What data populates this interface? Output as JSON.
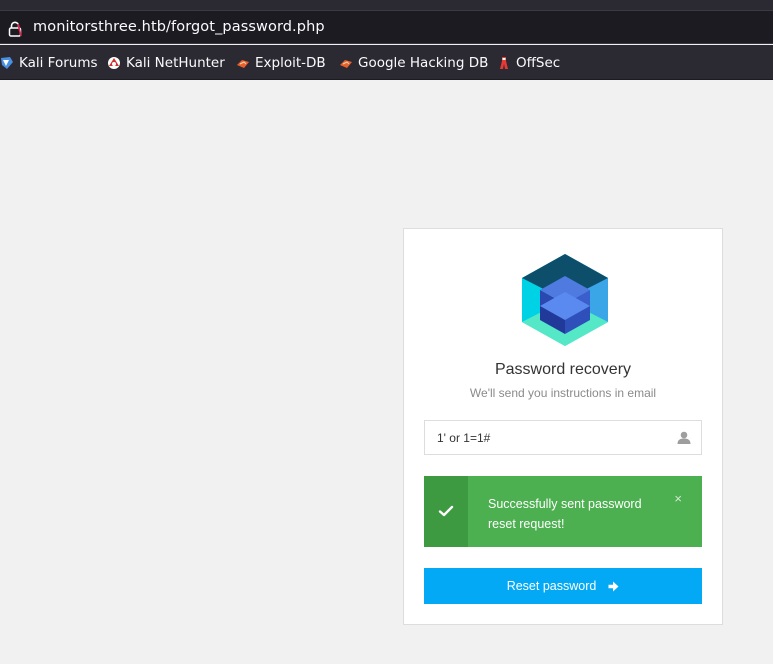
{
  "browser": {
    "url": "monitorsthree.htb/forgot_password.php",
    "bookmarks": [
      {
        "label": "Kali Forums",
        "icon": "kali-dragon-icon"
      },
      {
        "label": "Kali NetHunter",
        "icon": "nethunter-icon"
      },
      {
        "label": "Exploit-DB",
        "icon": "exploit-db-icon"
      },
      {
        "label": "Google Hacking DB",
        "icon": "ghdb-icon"
      },
      {
        "label": "OffSec",
        "icon": "offsec-icon"
      }
    ]
  },
  "card": {
    "logo_icon": "cube-logo-icon",
    "title": "Password recovery",
    "subtitle": "We'll send you instructions in email",
    "input": {
      "value": "1' or 1=1#",
      "icon": "user-icon"
    },
    "alert": {
      "message": "Successfully sent password reset request!",
      "close_label": "×",
      "icon": "check-icon",
      "color": "#4caf50"
    },
    "button": {
      "label": "Reset password",
      "icon": "arrow-right-icon",
      "color": "#03a9f4"
    }
  }
}
